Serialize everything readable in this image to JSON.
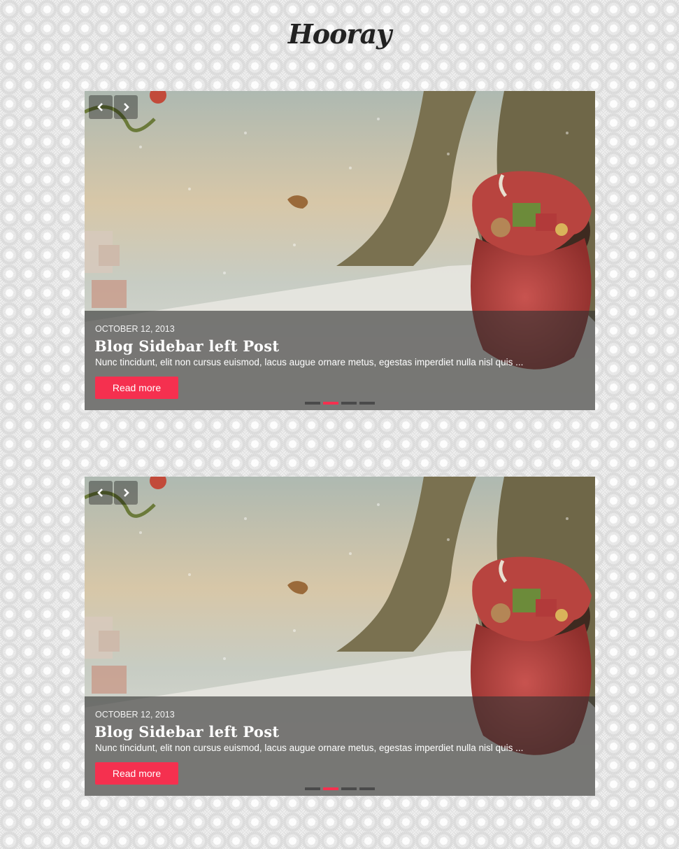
{
  "site": {
    "logo": "Hooray"
  },
  "sliders": [
    {
      "date": "OCTOBER 12, 2013",
      "title": "Blog Sidebar left Post",
      "excerpt": "Nunc tincidunt, elit non cursus euismod, lacus augue ornare metus, egestas imperdiet nulla nisl quis ...",
      "button": "Read more",
      "active_dot": 2,
      "dot_count": 4
    },
    {
      "date": "OCTOBER 12, 2013",
      "title": "Blog Sidebar left Post",
      "excerpt": "Nunc tincidunt, elit non cursus euismod, lacus augue ornare metus, egestas imperdiet nulla nisl quis ...",
      "button": "Read more",
      "active_dot": 2,
      "dot_count": 4
    }
  ],
  "colors": {
    "accent": "#f5304f",
    "caption_bg": "#323232"
  },
  "icons": {
    "prev": "chevron-left-icon",
    "next": "chevron-right-icon"
  }
}
